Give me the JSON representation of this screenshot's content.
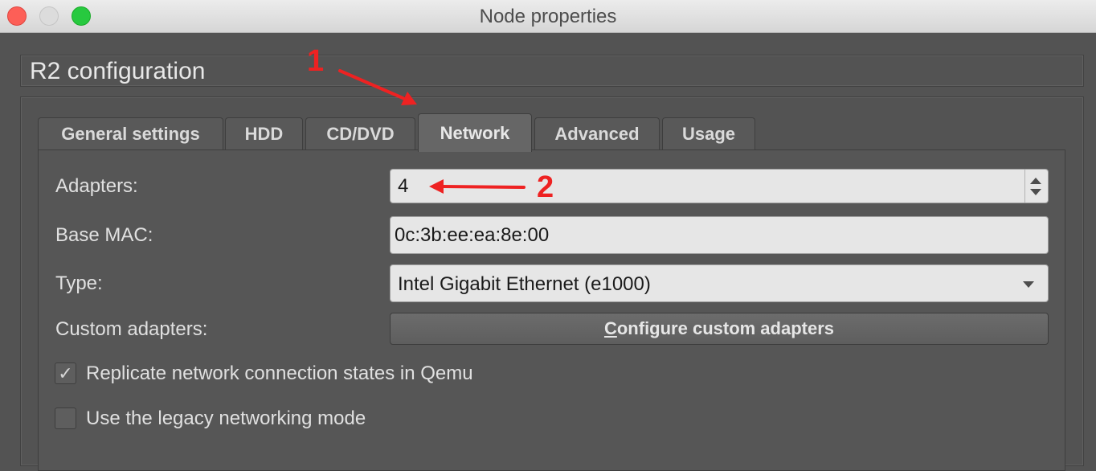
{
  "window": {
    "title": "Node properties",
    "controls": [
      "close",
      "minimize",
      "zoom"
    ]
  },
  "config": {
    "title": "R2 configuration"
  },
  "tabs": [
    {
      "label": "General settings",
      "active": false
    },
    {
      "label": "HDD",
      "active": false
    },
    {
      "label": "CD/DVD",
      "active": false
    },
    {
      "label": "Network",
      "active": true
    },
    {
      "label": "Advanced",
      "active": false
    },
    {
      "label": "Usage",
      "active": false
    }
  ],
  "network": {
    "adapters_label": "Adapters:",
    "adapters_value": "4",
    "base_mac_label": "Base MAC:",
    "base_mac_value": "0c:3b:ee:ea:8e:00",
    "type_label": "Type:",
    "type_value": "Intel Gigabit Ethernet (e1000)",
    "custom_adapters_label": "Custom adapters:",
    "configure_button_mnemonic": "C",
    "configure_button_rest": "onfigure custom adapters",
    "replicate_label": "Replicate network connection states in Qemu",
    "replicate_checked": true,
    "legacy_label": "Use the legacy networking mode",
    "legacy_checked": false
  },
  "annotations": {
    "marker_1": "1",
    "marker_2": "2",
    "color": "#ee2222"
  },
  "colors": {
    "background": "#535353",
    "field_background": "#e6e6e6",
    "annotation_red": "#ee2222"
  }
}
